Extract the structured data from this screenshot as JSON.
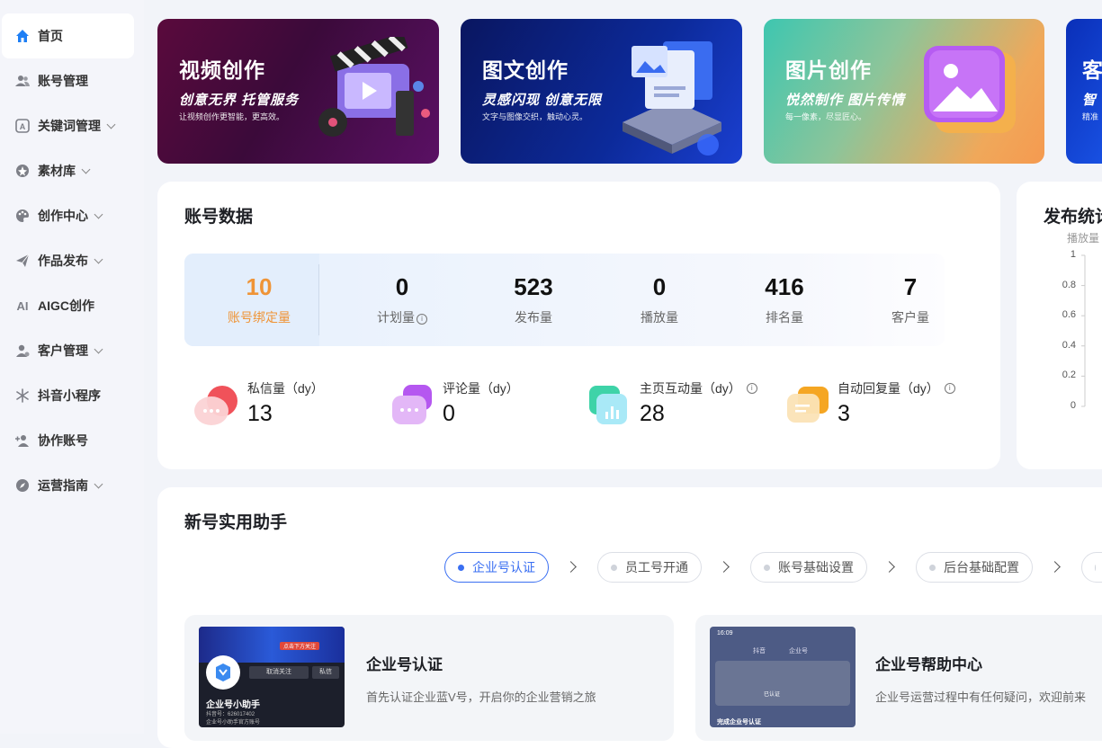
{
  "sidebar": {
    "items": [
      {
        "label": "首页",
        "icon": "home-icon",
        "active": true,
        "has_chevron": false
      },
      {
        "label": "账号管理",
        "icon": "users-icon",
        "has_chevron": false
      },
      {
        "label": "关键词管理",
        "icon": "keyword-icon",
        "has_chevron": true
      },
      {
        "label": "素材库",
        "icon": "material-icon",
        "has_chevron": true
      },
      {
        "label": "创作中心",
        "icon": "palette-icon",
        "has_chevron": true
      },
      {
        "label": "作品发布",
        "icon": "send-icon",
        "has_chevron": true
      },
      {
        "label": "AIGC创作",
        "icon": "ai-icon",
        "has_chevron": false
      },
      {
        "label": "客户管理",
        "icon": "customer-icon",
        "has_chevron": true
      },
      {
        "label": "抖音小程序",
        "icon": "miniprogram-icon",
        "has_chevron": false
      },
      {
        "label": "协作账号",
        "icon": "add-user-icon",
        "has_chevron": false
      },
      {
        "label": "运营指南",
        "icon": "compass-icon",
        "has_chevron": true
      }
    ],
    "ai_glyph": "AI"
  },
  "banners": [
    {
      "title": "视频创作",
      "subtitle": "创意无界 托管服务",
      "desc": "让视频创作更智能，更高效。"
    },
    {
      "title": "图文创作",
      "subtitle": "灵感闪现 创意无限",
      "desc": "文字与图像交织，触动心灵。"
    },
    {
      "title": "图片创作",
      "subtitle": "悦然制作 图片传情",
      "desc": "每一像素，尽显匠心。"
    },
    {
      "title": "客",
      "subtitle": "智",
      "desc": "精准"
    }
  ],
  "account_data": {
    "title": "账号数据",
    "stats": [
      {
        "value": "10",
        "label": "账号绑定量"
      },
      {
        "value": "0",
        "label": "计划量",
        "info": "i"
      },
      {
        "value": "523",
        "label": "发布量"
      },
      {
        "value": "0",
        "label": "播放量"
      },
      {
        "value": "416",
        "label": "排名量"
      },
      {
        "value": "7",
        "label": "客户量"
      }
    ],
    "metrics": [
      {
        "label": "私信量（dy）",
        "value": "13",
        "icon": "message-icon"
      },
      {
        "label": "评论量（dy）",
        "value": "0",
        "icon": "comment-icon"
      },
      {
        "label": "主页互动量（dy）",
        "value": "28",
        "icon": "interaction-icon",
        "info": "i"
      },
      {
        "label": "自动回复量（dy）",
        "value": "3",
        "icon": "auto-reply-icon",
        "info": "i"
      }
    ]
  },
  "publish_stats": {
    "title": "发布统计",
    "ylabel": "播放量",
    "yticks": [
      "1",
      "0.8",
      "0.6",
      "0.4",
      "0.2",
      "0"
    ]
  },
  "chart_data": {
    "type": "line",
    "title": "发布统计",
    "xlabel": "",
    "ylabel": "播放量",
    "ylim": [
      0,
      1
    ],
    "yticks": [
      0,
      0.2,
      0.4,
      0.6,
      0.8,
      1
    ],
    "series": [],
    "grid": false
  },
  "helper": {
    "title": "新号实用助手",
    "steps": [
      {
        "label": "企业号认证",
        "active": true
      },
      {
        "label": "员工号开通"
      },
      {
        "label": "账号基础设置"
      },
      {
        "label": "后台基础配置"
      }
    ],
    "cards": [
      {
        "title": "企业号认证",
        "desc": "首先认证企业蓝V号，开启你的企业营销之旅",
        "thumb": {
          "name": "企业号小助手",
          "follow": "取消关注",
          "dm": "私信",
          "id": "抖音号：626017402",
          "badge": "企业号小助手官方账号",
          "banner_text": "点击下方关注"
        }
      },
      {
        "title": "企业号帮助中心",
        "desc": "企业号运营过程中有任何疑问，欢迎前来",
        "thumb": {
          "time": "16:09",
          "tab1": "抖音",
          "tab2": "企业号",
          "status": "已认证",
          "bottom": "完成企业号认证"
        }
      }
    ]
  },
  "colors": {
    "accent": "#3a6ff2",
    "highlight": "#ef9437",
    "home_icon": "#1e7ff5"
  }
}
